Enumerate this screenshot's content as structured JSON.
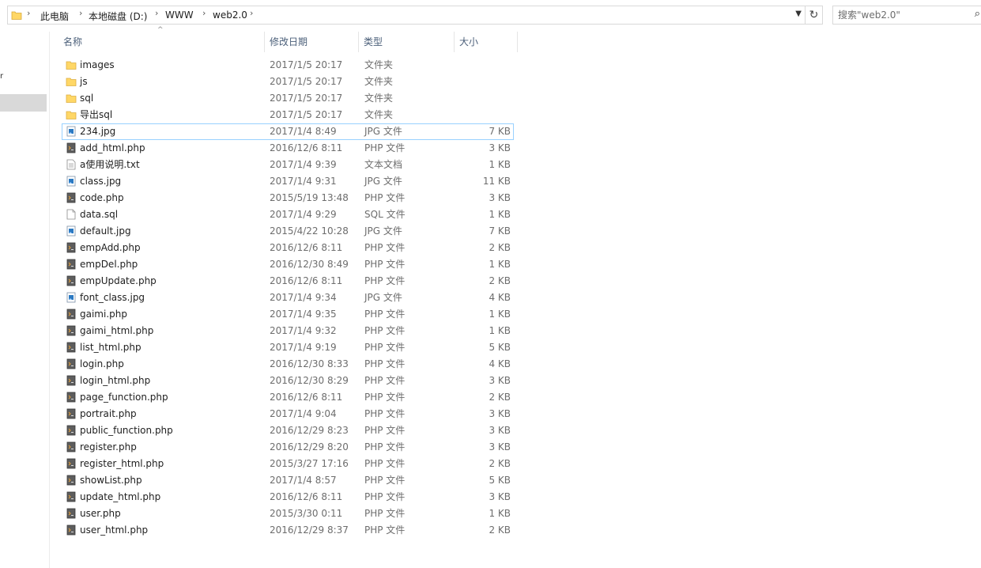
{
  "breadcrumb": [
    "此电脑",
    "本地磁盘 (D:)",
    "WWW",
    "web2.0"
  ],
  "search": {
    "placeholder": "搜索\"web2.0\""
  },
  "columns": {
    "name": "名称",
    "date": "修改日期",
    "type": "类型",
    "size": "大小"
  },
  "colors": {
    "selection": "#d9d9d9",
    "focus_border": "#99d1ff",
    "folder": "#ffd766",
    "header_text": "#4c607a"
  },
  "files": [
    {
      "name": "images",
      "date": "2017/1/5 20:17",
      "type": "文件夹",
      "size": "",
      "icon": "folder-icon"
    },
    {
      "name": "js",
      "date": "2017/1/5 20:17",
      "type": "文件夹",
      "size": "",
      "icon": "folder-icon"
    },
    {
      "name": "sql",
      "date": "2017/1/5 20:17",
      "type": "文件夹",
      "size": "",
      "icon": "folder-icon"
    },
    {
      "name": "导出sql",
      "date": "2017/1/5 20:17",
      "type": "文件夹",
      "size": "",
      "icon": "folder-icon"
    },
    {
      "name": "234.jpg",
      "date": "2017/1/4 8:49",
      "type": "JPG 文件",
      "size": "7 KB",
      "icon": "image-file-icon",
      "focused": true
    },
    {
      "name": "add_html.php",
      "date": "2016/12/6 8:11",
      "type": "PHP 文件",
      "size": "3 KB",
      "icon": "php-file-icon"
    },
    {
      "name": "a使用说明.txt",
      "date": "2017/1/4 9:39",
      "type": "文本文档",
      "size": "1 KB",
      "icon": "text-file-icon"
    },
    {
      "name": "class.jpg",
      "date": "2017/1/4 9:31",
      "type": "JPG 文件",
      "size": "11 KB",
      "icon": "image-file-icon"
    },
    {
      "name": "code.php",
      "date": "2015/5/19 13:48",
      "type": "PHP 文件",
      "size": "3 KB",
      "icon": "php-file-icon"
    },
    {
      "name": "data.sql",
      "date": "2017/1/4 9:29",
      "type": "SQL 文件",
      "size": "1 KB",
      "icon": "blank-file-icon"
    },
    {
      "name": "default.jpg",
      "date": "2015/4/22 10:28",
      "type": "JPG 文件",
      "size": "7 KB",
      "icon": "image-file-icon"
    },
    {
      "name": "empAdd.php",
      "date": "2016/12/6 8:11",
      "type": "PHP 文件",
      "size": "2 KB",
      "icon": "php-file-icon"
    },
    {
      "name": "empDel.php",
      "date": "2016/12/30 8:49",
      "type": "PHP 文件",
      "size": "1 KB",
      "icon": "php-file-icon"
    },
    {
      "name": "empUpdate.php",
      "date": "2016/12/6 8:11",
      "type": "PHP 文件",
      "size": "2 KB",
      "icon": "php-file-icon"
    },
    {
      "name": "font_class.jpg",
      "date": "2017/1/4 9:34",
      "type": "JPG 文件",
      "size": "4 KB",
      "icon": "image-file-icon"
    },
    {
      "name": "gaimi.php",
      "date": "2017/1/4 9:35",
      "type": "PHP 文件",
      "size": "1 KB",
      "icon": "php-file-icon"
    },
    {
      "name": "gaimi_html.php",
      "date": "2017/1/4 9:32",
      "type": "PHP 文件",
      "size": "1 KB",
      "icon": "php-file-icon"
    },
    {
      "name": "list_html.php",
      "date": "2017/1/4 9:19",
      "type": "PHP 文件",
      "size": "5 KB",
      "icon": "php-file-icon"
    },
    {
      "name": "login.php",
      "date": "2016/12/30 8:33",
      "type": "PHP 文件",
      "size": "4 KB",
      "icon": "php-file-icon"
    },
    {
      "name": "login_html.php",
      "date": "2016/12/30 8:29",
      "type": "PHP 文件",
      "size": "3 KB",
      "icon": "php-file-icon"
    },
    {
      "name": "page_function.php",
      "date": "2016/12/6 8:11",
      "type": "PHP 文件",
      "size": "2 KB",
      "icon": "php-file-icon"
    },
    {
      "name": "portrait.php",
      "date": "2017/1/4 9:04",
      "type": "PHP 文件",
      "size": "3 KB",
      "icon": "php-file-icon"
    },
    {
      "name": "public_function.php",
      "date": "2016/12/29 8:23",
      "type": "PHP 文件",
      "size": "3 KB",
      "icon": "php-file-icon"
    },
    {
      "name": "register.php",
      "date": "2016/12/29 8:20",
      "type": "PHP 文件",
      "size": "3 KB",
      "icon": "php-file-icon"
    },
    {
      "name": "register_html.php",
      "date": "2015/3/27 17:16",
      "type": "PHP 文件",
      "size": "2 KB",
      "icon": "php-file-icon"
    },
    {
      "name": "showList.php",
      "date": "2017/1/4 8:57",
      "type": "PHP 文件",
      "size": "5 KB",
      "icon": "php-file-icon"
    },
    {
      "name": "update_html.php",
      "date": "2016/12/6 8:11",
      "type": "PHP 文件",
      "size": "3 KB",
      "icon": "php-file-icon"
    },
    {
      "name": "user.php",
      "date": "2015/3/30 0:11",
      "type": "PHP 文件",
      "size": "1 KB",
      "icon": "php-file-icon"
    },
    {
      "name": "user_html.php",
      "date": "2016/12/29 8:37",
      "type": "PHP 文件",
      "size": "2 KB",
      "icon": "php-file-icon"
    }
  ]
}
